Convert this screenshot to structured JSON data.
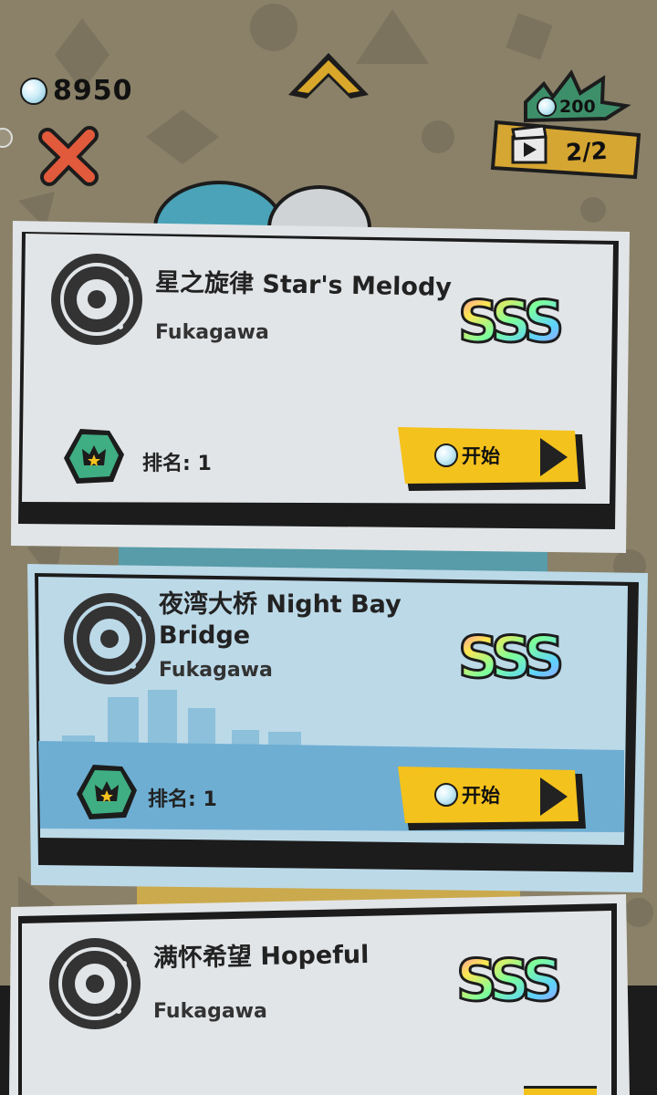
{
  "hud": {
    "currency_value": "8950",
    "video_ad": {
      "cost": "200",
      "count": "2/2"
    }
  },
  "songs": [
    {
      "title_line1": "星之旋律 Star's Melody",
      "title_line2": "",
      "artist": "Fukagawa",
      "grade": "SSS",
      "rank_label": "排名: 1",
      "start_label": "开始"
    },
    {
      "title_line1": "夜湾大桥 Night Bay",
      "title_line2": "Bridge",
      "artist": "Fukagawa",
      "grade": "SSS",
      "rank_label": "排名: 1",
      "start_label": "开始"
    },
    {
      "title_line1": "满怀希望 Hopeful",
      "title_line2": "",
      "artist": "Fukagawa",
      "grade": "SSS",
      "rank_label": "",
      "start_label": ""
    }
  ],
  "colors": {
    "background": "#8a8168",
    "card_light": "#e2e5e8",
    "card_blue": "#bcd9e8",
    "button_yellow": "#f4c21c",
    "rank_green": "#3fae83",
    "close_red": "#e25a3c"
  },
  "icons": [
    "pearl-currency-icon",
    "close-icon",
    "scroll-up-icon",
    "video-ad-icon",
    "disc-icon",
    "rank-crown-icon",
    "play-icon"
  ]
}
